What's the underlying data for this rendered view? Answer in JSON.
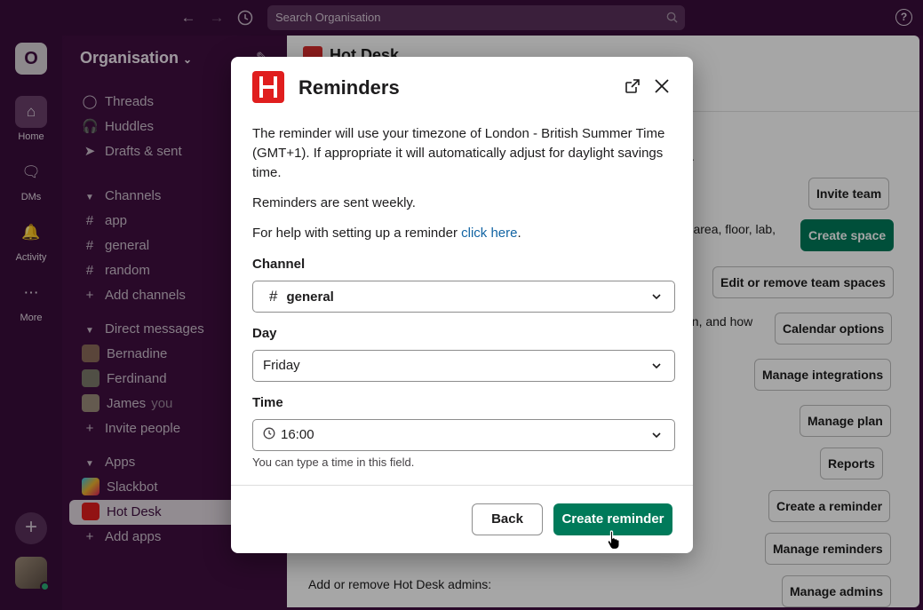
{
  "topbar": {
    "search_placeholder": "Search Organisation",
    "help_label": "?"
  },
  "rail": {
    "workspace_initial": "O",
    "items": [
      {
        "label": "Home",
        "icon": "home-icon"
      },
      {
        "label": "DMs",
        "icon": "dms-icon"
      },
      {
        "label": "Activity",
        "icon": "bell-icon"
      },
      {
        "label": "More",
        "icon": "more-icon"
      }
    ],
    "plus_label": "+"
  },
  "sidebar": {
    "workspace_name": "Organisation",
    "top_items": [
      {
        "label": "Threads",
        "icon": "threads-icon"
      },
      {
        "label": "Huddles",
        "icon": "headphones-icon"
      },
      {
        "label": "Drafts & sent",
        "icon": "send-icon"
      }
    ],
    "channels_header": "Channels",
    "channels": [
      "app",
      "general",
      "random"
    ],
    "add_channels": "Add channels",
    "dm_header": "Direct messages",
    "dms": [
      {
        "name": "Bernadine"
      },
      {
        "name": "Ferdinand"
      },
      {
        "name": "James",
        "suffix": "you"
      }
    ],
    "invite_people": "Invite people",
    "apps_header": "Apps",
    "apps": [
      "Slackbot",
      "Hot Desk"
    ],
    "add_apps": "Add apps"
  },
  "main": {
    "title": "Hot Desk",
    "text_fragments": [
      ".",
      "ng area, floor, lab,",
      "en, and how",
      "Add or remove Hot Desk admins:"
    ],
    "buttons": [
      "Invite team",
      "Create space",
      "Edit or remove team spaces",
      "Calendar options",
      "Manage integrations",
      "Manage plan",
      "Reports",
      "Create a reminder",
      "Manage reminders",
      "Manage admins"
    ]
  },
  "modal": {
    "title": "Reminders",
    "intro": "The reminder will use your timezone of London - British Summer Time (GMT+1). If appropriate it will automatically adjust for daylight savings time.",
    "weekly_note": "Reminders are sent weekly.",
    "help_prefix": "For help with setting up a reminder ",
    "help_link": "click here",
    "help_suffix": ".",
    "channel_label": "Channel",
    "channel_value": "general",
    "day_label": "Day",
    "day_value": "Friday",
    "time_label": "Time",
    "time_value": "16:00",
    "time_hint": "You can type a time in this field.",
    "back_label": "Back",
    "create_label": "Create reminder"
  },
  "colors": {
    "sidebar_bg": "#3f0e40",
    "accent_green": "#007a5a",
    "link_blue": "#1264a3",
    "brand_red": "#e01e1e"
  }
}
